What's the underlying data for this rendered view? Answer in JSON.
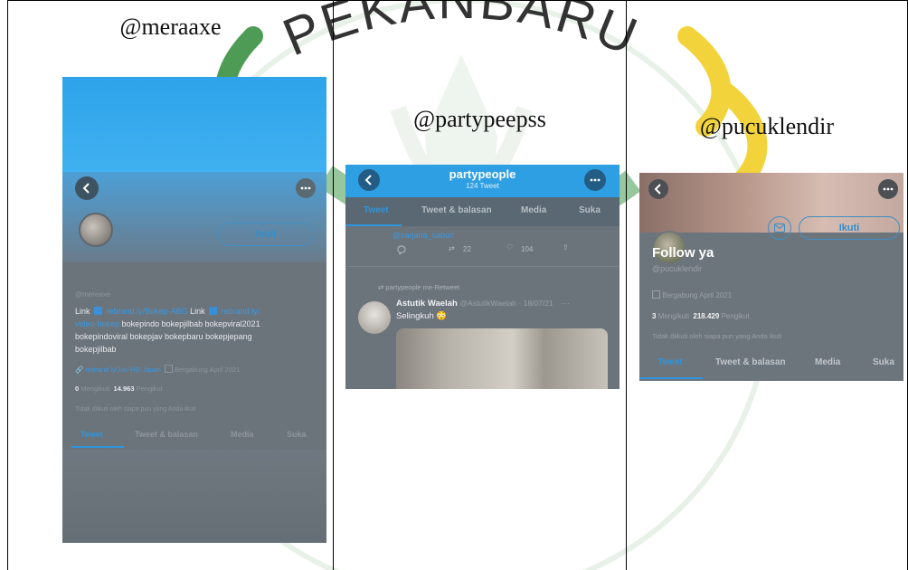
{
  "watermark": {
    "text": "PEKANBARU"
  },
  "panels": [
    {
      "caption": "@meraaxe",
      "profile": {
        "follow_label": "Ikuti",
        "username": "@mereaxe",
        "bio": {
          "link_word_1": "Link",
          "link_1": "rebrand.ly/Bokep-ABG",
          "link_word_2": "Link",
          "link_2a": "rebrand.ly/",
          "link_2b": "video-bokep",
          "tags_1": "bokepindo bokepjilbab bokepviral2021",
          "tags_2": "bokepindoviral bokepjav bokepbaru bokepjepang",
          "tags_3": "bokepjilbab"
        },
        "website": "rebrand.ly/Jav-HD-Japan",
        "joined": "Bergabung April 2021",
        "following_count": "0",
        "following_label": "Mengikuti",
        "followers_count": "14.963",
        "followers_label": "Pengikut",
        "not_followed": "Tidak diikuti oleh siapa pun yang Anda ikuti",
        "tabs": [
          "Tweet",
          "Tweet & balasan",
          "Media",
          "Suka"
        ]
      }
    },
    {
      "caption": "@partypeepss",
      "profile": {
        "header_name": "partypeople",
        "header_count": "124 Tweet",
        "tabs": [
          "Tweet",
          "Tweet & balasan",
          "Media",
          "Suka"
        ],
        "prev_tweet": {
          "mention": "@sarjana_sabun",
          "retweets": "22",
          "likes": "104"
        },
        "retweet_note": "partypeople me-Retweet",
        "tweet": {
          "author": "Astutik Waelah",
          "meta": "@AstutikWaelah · 18/07/21",
          "text": "Selingkuh",
          "emoji": "😳"
        }
      }
    },
    {
      "caption": "@pucuklendir",
      "profile": {
        "follow_label": "Ikuti",
        "display_name": "Follow ya",
        "username": "@pucuklendir",
        "joined": "Bergabung April 2021",
        "following_count": "3",
        "following_label": "Mengikuti",
        "followers_count": "218.429",
        "followers_label": "Pengikut",
        "not_followed": "Tidak diikuti oleh siapa pun yang Anda ikuti",
        "tabs": [
          "Tweet",
          "Tweet & balasan",
          "Media",
          "Suka"
        ]
      }
    }
  ],
  "colors": {
    "twitter_blue": "#1da1f2",
    "watermark_green": "#2f8a38",
    "watermark_yellow": "#f2d33b",
    "dim_gray_bg": "#6f767d"
  }
}
